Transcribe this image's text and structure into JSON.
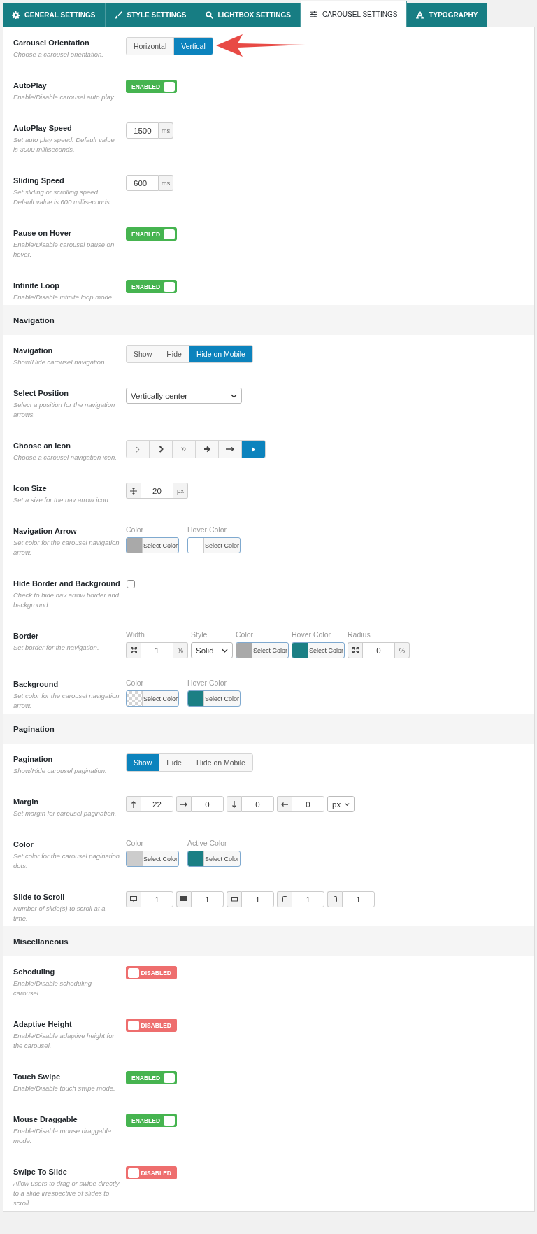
{
  "tabs": [
    {
      "label": "GENERAL SETTINGS",
      "selected": false
    },
    {
      "label": "STYLE SETTINGS",
      "selected": false
    },
    {
      "label": "LIGHTBOX SETTINGS",
      "selected": false
    },
    {
      "label": "CAROUSEL SETTINGS",
      "selected": true
    },
    {
      "label": "TYPOGRAPHY",
      "selected": false
    }
  ],
  "sections": [
    {
      "rows": [
        {
          "kind": "segmented",
          "label": "Carousel Orientation",
          "description": "Choose a carousel orientation.",
          "annotated": true,
          "options": [
            {
              "label": "Horizontal",
              "selected": false
            },
            {
              "label": "Vertical",
              "selected": true
            }
          ]
        },
        {
          "kind": "toggle",
          "label": "AutoPlay",
          "description": "Enable/Disable carousel auto play.",
          "on": true,
          "state_text": "ENABLED"
        },
        {
          "kind": "number",
          "label": "AutoPlay Speed",
          "description": "Set auto play speed. Default value is 3000 milliseconds.",
          "value": "1500",
          "unit": "ms"
        },
        {
          "kind": "number",
          "label": "Sliding Speed",
          "description": "Set sliding or scrolling speed. Default value is 600 milliseconds.",
          "value": "600",
          "unit": "ms"
        },
        {
          "kind": "toggle",
          "label": "Pause on Hover",
          "description": "Enable/Disable carousel pause on hover.",
          "on": true,
          "state_text": "ENABLED"
        },
        {
          "kind": "toggle",
          "label": "Infinite Loop",
          "description": "Enable/Disable infinite loop mode.",
          "on": true,
          "state_text": "ENABLED"
        }
      ]
    },
    {
      "title": "Navigation",
      "rows": [
        {
          "kind": "segmented",
          "label": "Navigation",
          "description": "Show/Hide carousel navigation.",
          "options": [
            {
              "label": "Show",
              "selected": false
            },
            {
              "label": "Hide",
              "selected": false
            },
            {
              "label": "Hide on Mobile",
              "selected": true
            }
          ]
        },
        {
          "kind": "select",
          "label": "Select Position",
          "description": "Select a position for the navigation arrows.",
          "value": "Vertically center"
        },
        {
          "kind": "icon_choice",
          "label": "Choose an Icon",
          "description": "Choose a carousel navigation icon.",
          "options": [
            {
              "selected": false
            },
            {
              "selected": false
            },
            {
              "selected": false
            },
            {
              "selected": false
            },
            {
              "selected": false
            },
            {
              "selected": true
            }
          ]
        },
        {
          "kind": "size",
          "label": "Icon Size",
          "description": "Set a size for the nav arrow icon.",
          "fields": [
            {
              "kind": "input",
              "value": "20",
              "unit": "px"
            }
          ]
        },
        {
          "kind": "colors",
          "label": "Navigation Arrow",
          "description": "Set color for the carousel navigation arrow.",
          "fields": [
            {
              "kind": "color",
              "caption": "Color",
              "color": "#a9a9a9",
              "transparent": false,
              "button": "Select Color"
            },
            {
              "kind": "color",
              "caption": "Hover Color",
              "color": "#ffffff",
              "transparent": false,
              "button": "Select Color"
            }
          ]
        },
        {
          "kind": "checkbox",
          "label": "Hide Border and Background",
          "description": "Check to hide nav arrow border and background.",
          "checked": false
        },
        {
          "kind": "border",
          "label": "Border",
          "description": "Set border for the navigation.",
          "fields": [
            {
              "kind": "input",
              "caption": "Width",
              "value": "1",
              "unit": "%"
            },
            {
              "kind": "select",
              "caption": "Style",
              "value": "Solid"
            },
            {
              "kind": "color",
              "caption": "Color",
              "color": "#a9a9a9",
              "transparent": false,
              "button": "Select Color"
            },
            {
              "kind": "color",
              "caption": "Hover Color",
              "color": "#1b7f84",
              "transparent": false,
              "button": "Select Color"
            },
            {
              "kind": "input",
              "caption": "Radius",
              "value": "0",
              "unit": "%"
            }
          ]
        },
        {
          "kind": "colors",
          "label": "Background",
          "description": "Set color for the carousel navigation arrow.",
          "fields": [
            {
              "kind": "color",
              "caption": "Color",
              "transparent": true,
              "button": "Select Color"
            },
            {
              "kind": "color",
              "caption": "Hover Color",
              "color": "#1b7f84",
              "transparent": false,
              "button": "Select Color"
            }
          ]
        }
      ]
    },
    {
      "title": "Pagination",
      "rows": [
        {
          "kind": "segmented",
          "label": "Pagination",
          "description": "Show/Hide carousel pagination.",
          "options": [
            {
              "label": "Show",
              "selected": true
            },
            {
              "label": "Hide",
              "selected": false
            },
            {
              "label": "Hide on Mobile",
              "selected": false
            }
          ]
        },
        {
          "kind": "margin",
          "label": "Margin",
          "description": "Set margin for carousel pagination.",
          "fields": [
            {
              "kind": "input",
              "value": "22"
            },
            {
              "kind": "input",
              "value": "0"
            },
            {
              "kind": "input",
              "value": "0"
            },
            {
              "kind": "input",
              "value": "0"
            },
            {
              "kind": "select",
              "value": "px"
            }
          ]
        },
        {
          "kind": "colors",
          "label": "Color",
          "description": "Set color for the carousel pagination dots.",
          "fields": [
            {
              "kind": "color",
              "caption": "Color",
              "color": "#cccccc",
              "transparent": false,
              "button": "Select Color"
            },
            {
              "kind": "color",
              "caption": "Active Color",
              "color": "#1b7f84",
              "transparent": false,
              "button": "Select Color"
            }
          ]
        },
        {
          "kind": "devices",
          "label": "Slide to Scroll",
          "description": "Number of slide(s) to scroll at a time.",
          "fields": [
            {
              "kind": "input",
              "value": "1"
            },
            {
              "kind": "input",
              "value": "1"
            },
            {
              "kind": "input",
              "value": "1"
            },
            {
              "kind": "input",
              "value": "1"
            },
            {
              "kind": "input",
              "value": "1"
            }
          ]
        }
      ]
    },
    {
      "title": "Miscellaneous",
      "rows": [
        {
          "kind": "toggle",
          "label": "Scheduling",
          "description": "Enable/Disable scheduling carousel.",
          "on": false,
          "state_text": "DISABLED"
        },
        {
          "kind": "toggle",
          "label": "Adaptive Height",
          "description": "Enable/Disable adaptive height for the carousel.",
          "on": false,
          "state_text": "DISABLED"
        },
        {
          "kind": "toggle",
          "label": "Touch Swipe",
          "description": "Enable/Disable touch swipe mode.",
          "on": true,
          "state_text": "ENABLED"
        },
        {
          "kind": "toggle",
          "label": "Mouse Draggable",
          "description": "Enable/Disable mouse draggable mode.",
          "on": true,
          "state_text": "ENABLED"
        },
        {
          "kind": "toggle",
          "label": "Swipe To Slide",
          "description": "Allow users to drag or swipe directly to a slide irrespective of slides to scroll.",
          "on": false,
          "state_text": "DISABLED"
        }
      ]
    }
  ]
}
